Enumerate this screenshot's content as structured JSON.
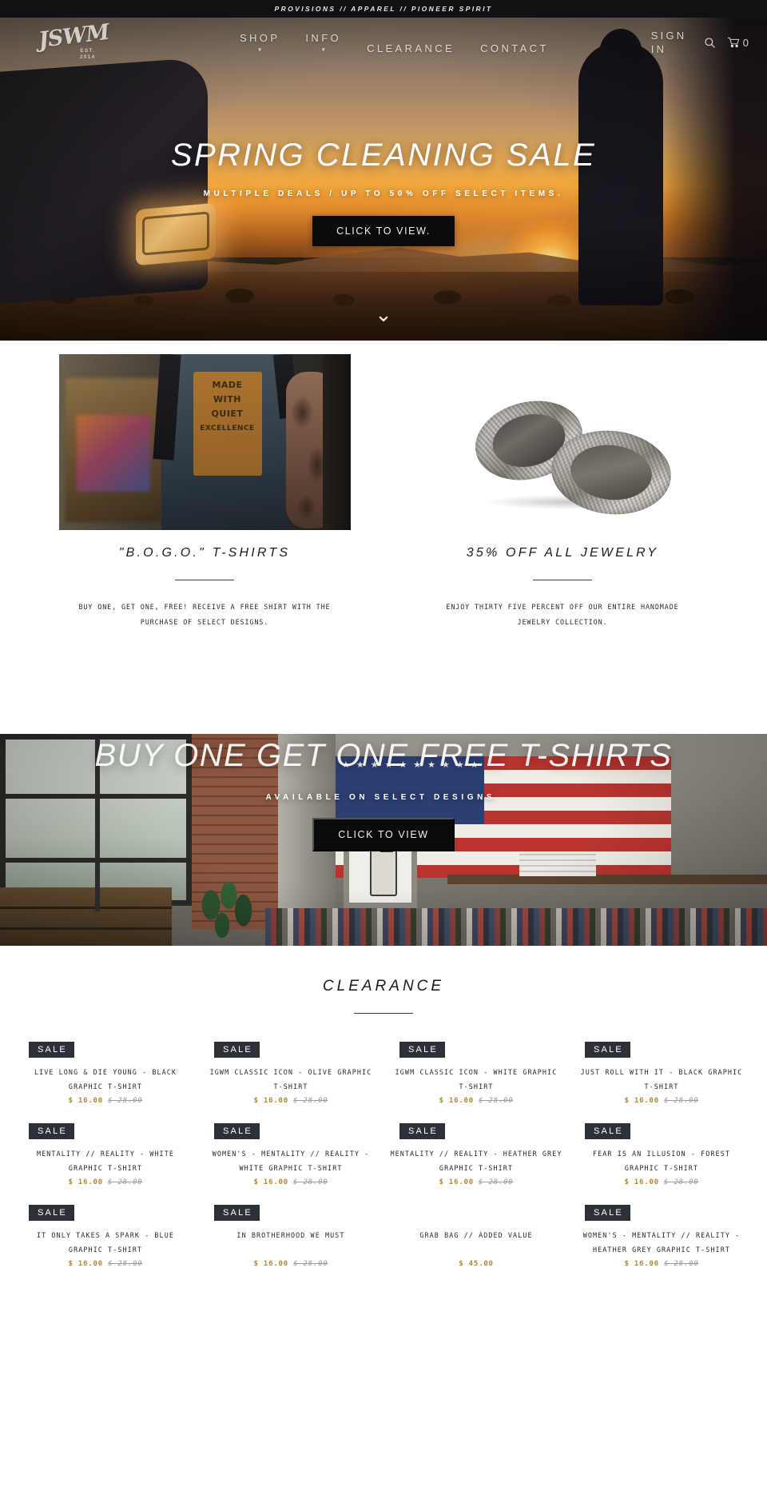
{
  "announcement": {
    "text": "PROVISIONS // APPAREL // PIONEER SPIRIT"
  },
  "nav": {
    "logo_mark": "JSWM",
    "logo_est_line1": "EST.",
    "logo_est_line2": "2014",
    "items": [
      {
        "label": "SHOP",
        "has_dropdown": true
      },
      {
        "label": "INFO",
        "has_dropdown": true
      },
      {
        "label": "CLEARANCE",
        "has_dropdown": false
      },
      {
        "label": "CONTACT",
        "has_dropdown": false
      }
    ],
    "sign_in": "SIGN IN",
    "search_icon": "search-icon",
    "cart_icon": "cart-icon",
    "cart_count": "0"
  },
  "hero1": {
    "title": "SPRING CLEANING SALE",
    "subtitle": "MULTIPLE DEALS / UP TO 50% OFF SELECT ITEMS.",
    "button": "CLICK TO VIEW.",
    "scroll_icon": "chevron-down-icon"
  },
  "promos": [
    {
      "image_alt": "man-wearing-graphic-tshirt",
      "shirt_print_line1": "MADE",
      "shirt_print_line2": "WITH",
      "shirt_print_line3": "QUIET",
      "shirt_print_line4": "EXCELLENCE",
      "title": "\"B.O.G.O.\" T-SHIRTS",
      "text": "BUY ONE, GET ONE, FREE! RECEIVE A FREE SHIRT WITH THE PURCHASE OF SELECT DESIGNS."
    },
    {
      "image_alt": "silver-handmade-rings",
      "title": "35% OFF ALL JEWELRY",
      "text": "ENJOY THIRTY FIVE PERCENT OFF OUR ENTIRE HANDMADE JEWELRY COLLECTION."
    }
  ],
  "hero2": {
    "title": "BUY ONE GET ONE FREE T-SHIRTS",
    "subtitle": "AVAILABLE ON SELECT DESIGNS.",
    "button": "CLICK TO VIEW"
  },
  "clearance": {
    "heading": "CLEARANCE",
    "badge_label": "SALE",
    "products": [
      {
        "title": "LIVE LONG & DIE YOUNG - BLACK GRAPHIC T-SHIRT",
        "sale_price": "$ 16.00",
        "orig_price": "$ 28.00",
        "on_sale": true
      },
      {
        "title": "IGWM CLASSIC ICON - OLIVE GRAPHIC T-SHIRT",
        "sale_price": "$ 16.00",
        "orig_price": "$ 28.00",
        "on_sale": true
      },
      {
        "title": "IGWM CLASSIC ICON - WHITE GRAPHIC T-SHIRT",
        "sale_price": "$ 16.00",
        "orig_price": "$ 28.00",
        "on_sale": true
      },
      {
        "title": "JUST ROLL WITH IT - BLACK GRAPHIC T-SHIRT",
        "sale_price": "$ 16.00",
        "orig_price": "$ 28.00",
        "on_sale": true
      },
      {
        "title": "MENTALITY // REALITY - WHITE GRAPHIC T-SHIRT",
        "sale_price": "$ 16.00",
        "orig_price": "$ 28.00",
        "on_sale": true
      },
      {
        "title": "WOMEN'S - MENTALITY // REALITY - WHITE GRAPHIC T-SHIRT",
        "sale_price": "$ 16.00",
        "orig_price": "$ 28.00",
        "on_sale": true
      },
      {
        "title": "MENTALITY // REALITY - HEATHER GREY GRAPHIC T-SHIRT",
        "sale_price": "$ 16.00",
        "orig_price": "$ 28.00",
        "on_sale": true
      },
      {
        "title": "FEAR IS AN ILLUSION - FOREST GRAPHIC T-SHIRT",
        "sale_price": "$ 16.00",
        "orig_price": "$ 28.00",
        "on_sale": true
      },
      {
        "title": "IT ONLY TAKES A SPARK - BLUE GRAPHIC T-SHIRT",
        "sale_price": "$ 16.00",
        "orig_price": "$ 28.00",
        "on_sale": true
      },
      {
        "title": "IN BROTHERHOOD WE MUST",
        "sale_price": "$ 16.00",
        "orig_price": "$ 28.00",
        "on_sale": true
      },
      {
        "title": "GRAB BAG // ADDED VALUE",
        "sale_price": "$ 45.00",
        "orig_price": "",
        "on_sale": false
      },
      {
        "title": "WOMEN'S - MENTALITY // REALITY - HEATHER GREY GRAPHIC T-SHIRT",
        "sale_price": "$ 16.00",
        "orig_price": "$ 28.00",
        "on_sale": true
      }
    ]
  },
  "colors": {
    "accent_price": "#b08a33",
    "badge_bg": "#2b3136",
    "dark_bar": "#111113",
    "button_bg": "#0b0b0c"
  }
}
